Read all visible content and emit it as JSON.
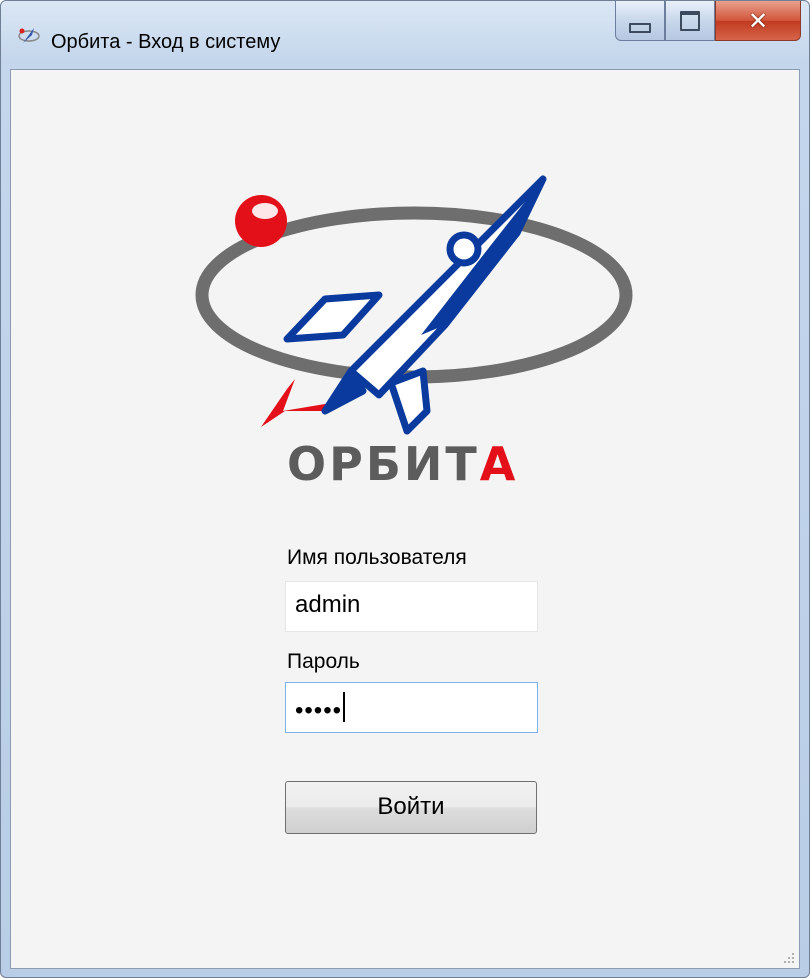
{
  "window": {
    "title": "Орбита - Вход в систему",
    "controls": {
      "minimize": "minimize",
      "maximize": "maximize",
      "close": "close"
    }
  },
  "logo": {
    "wordmark_prefix": "ОРБИТ",
    "wordmark_suffix": "А"
  },
  "form": {
    "username_label": "Имя пользователя",
    "username_value": "admin",
    "password_label": "Пароль",
    "password_value": "•••••",
    "login_button": "Войти"
  },
  "colors": {
    "accent_red": "#e3101a",
    "rocket_blue": "#0a3a9e",
    "orbit_gray": "#6e6e6e"
  }
}
